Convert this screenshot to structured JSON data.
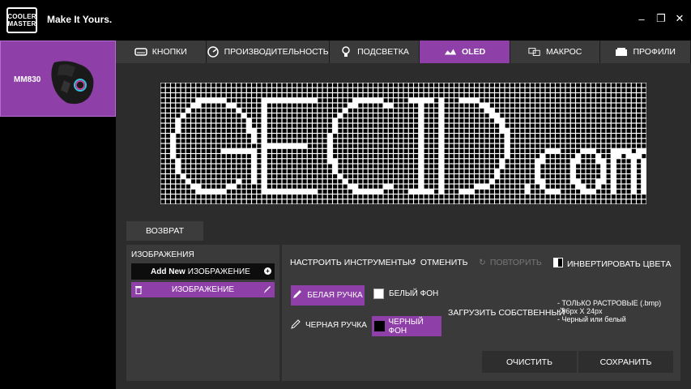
{
  "brand": {
    "logo_line1": "COOLER",
    "logo_line2": "MASTER",
    "tagline": "Make It Yours."
  },
  "window": {
    "minimize": "–",
    "maximize": "❐",
    "close": "✕"
  },
  "sidebar": {
    "device_name": "MM830"
  },
  "tabs": [
    {
      "label": "КНОПКИ",
      "icon": "buttons-icon"
    },
    {
      "label": "ПРОИЗВОДИТЕЛЬНОСТЬ",
      "icon": "performance-icon"
    },
    {
      "label": "ПОДСВЕТКА",
      "icon": "lighting-icon"
    },
    {
      "label": "OLED",
      "icon": "oled-icon",
      "active": true
    },
    {
      "label": "МАКРОС",
      "icon": "macro-icon"
    },
    {
      "label": "ПРОФИЛИ",
      "icon": "profiles-icon"
    }
  ],
  "oled": {
    "columns": 96,
    "rows": 24,
    "text": "GECID.com"
  },
  "back_button": "ВОЗВРАТ",
  "images": {
    "title": "ИЗОБРАЖЕНИЯ",
    "add_new_bold": "Add New",
    "add_new_rest": "ИЗОБРАЖЕНИЕ",
    "item": "ИЗОБРАЖЕНИЕ"
  },
  "tools": {
    "configure": "НАСТРОИТЬ ИНСТРУМЕНТЫ",
    "undo": "ОТМЕНИТЬ",
    "redo": "ПОВТОРИТЬ",
    "invert": "ИНВЕРТИРОВАТЬ ЦВЕТА",
    "white_pen": "БЕЛАЯ РУЧКА",
    "white_bg": "БЕЛЫЙ ФОН",
    "black_pen": "ЧЕРНАЯ РУЧКА",
    "black_bg": "ЧЕРНЫЙ ФОН",
    "upload_own": "ЗАГРУЗИТЬ СОБСТВЕННЫЙ",
    "note1": "- ТОЛЬКО РАСТРОВЫЕ (.bmp)",
    "note2": "- 96px X 24px",
    "note3": "- Черный или белый",
    "clear": "ОЧИСТИТЬ",
    "save": "СОХРАНИТЬ"
  },
  "colors": {
    "accent": "#8e3fa8",
    "panel": "#3a3a3a",
    "background": "#2c2c2c"
  }
}
